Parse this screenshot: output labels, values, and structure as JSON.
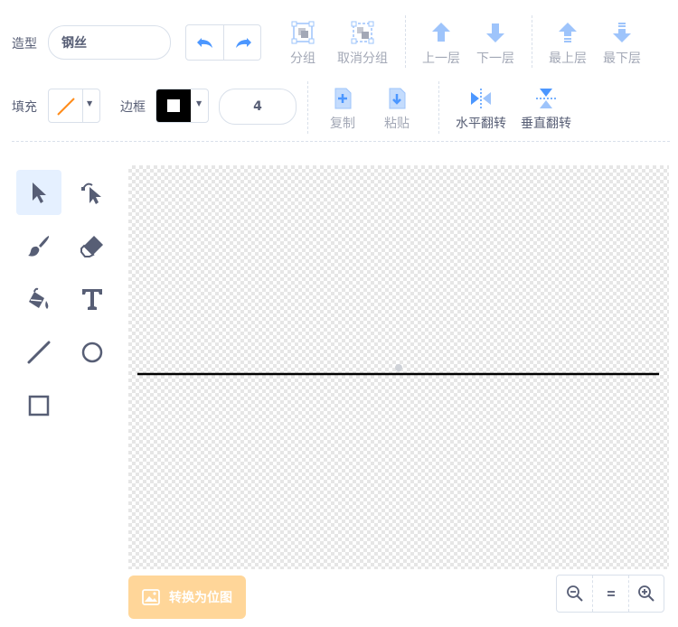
{
  "costume": {
    "label": "造型",
    "name_value": "钢丝"
  },
  "toolbar": {
    "group": "分组",
    "ungroup": "取消分组",
    "forward": "上一层",
    "backward": "下一层",
    "front": "最上层",
    "back": "最下层",
    "copy": "复制",
    "paste": "粘贴",
    "flip_h": "水平翻转",
    "flip_v": "垂直翻转"
  },
  "fill": {
    "label": "填充",
    "color": "#ff8c1a"
  },
  "outline": {
    "label": "边框",
    "color": "#000000",
    "width": "4"
  },
  "tools": [
    {
      "name": "select",
      "icon": "arrow-pointer-icon",
      "selected": true
    },
    {
      "name": "reshape",
      "icon": "reshape-icon",
      "selected": false
    },
    {
      "name": "brush",
      "icon": "brush-icon",
      "selected": false
    },
    {
      "name": "eraser",
      "icon": "eraser-icon",
      "selected": false
    },
    {
      "name": "fill",
      "icon": "paint-bucket-icon",
      "selected": false
    },
    {
      "name": "text",
      "icon": "text-icon",
      "selected": false
    },
    {
      "name": "line",
      "icon": "line-icon",
      "selected": false
    },
    {
      "name": "circle",
      "icon": "circle-icon",
      "selected": false
    },
    {
      "name": "rectangle",
      "icon": "rectangle-icon",
      "selected": false
    }
  ],
  "convert_button": "转换为位图",
  "zoom": {
    "out": "zoom-out-icon",
    "reset": "zoom-reset-icon",
    "in": "zoom-in-icon"
  },
  "colors": {
    "accent": "#4c97ff",
    "muted": "#a3a8b6",
    "text": "#575e75",
    "convert_bg": "#ffd699"
  }
}
